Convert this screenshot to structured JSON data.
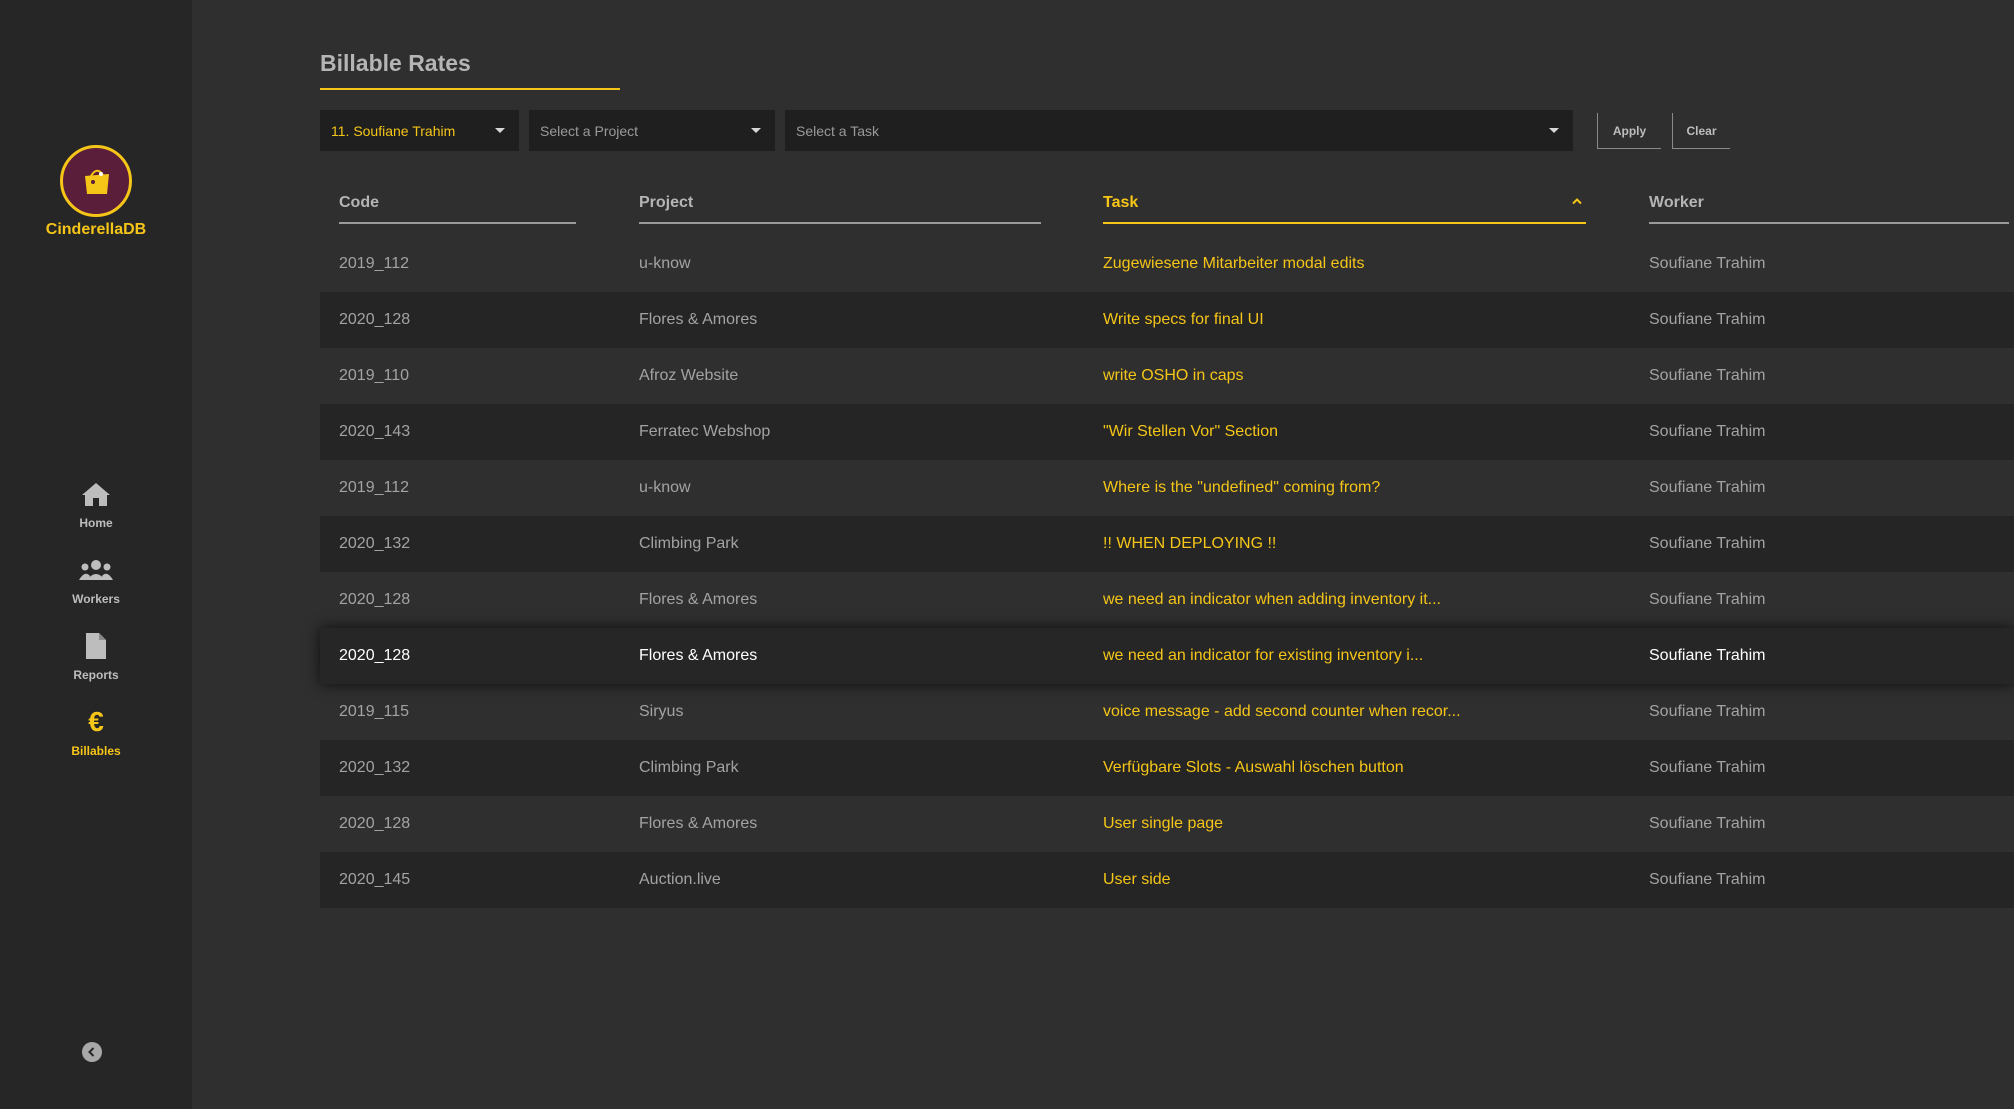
{
  "app": {
    "name": "CinderellaDB"
  },
  "sidebar": {
    "items": [
      {
        "label": "Home",
        "icon": "home-icon",
        "active": false
      },
      {
        "label": "Workers",
        "icon": "users-icon",
        "active": false
      },
      {
        "label": "Reports",
        "icon": "file-icon",
        "active": false
      },
      {
        "label": "Billables",
        "icon": "euro-icon",
        "active": true
      }
    ],
    "euro_symbol": "€"
  },
  "page": {
    "title": "Billable Rates"
  },
  "filters": {
    "worker_select": {
      "value": "11. Soufiane Trahim"
    },
    "project_select": {
      "placeholder": "Select a Project"
    },
    "task_select": {
      "placeholder": "Select a Task"
    },
    "apply_label": "Apply",
    "clear_label": "Clear"
  },
  "table": {
    "columns": [
      {
        "label": "Code"
      },
      {
        "label": "Project"
      },
      {
        "label": "Task",
        "sorted": "ascending"
      },
      {
        "label": "Worker"
      }
    ],
    "rows": [
      {
        "code": "2019_112",
        "project": "u-know",
        "task": "Zugewiesene Mitarbeiter modal edits",
        "worker": "Soufiane Trahim"
      },
      {
        "code": "2020_128",
        "project": "Flores & Amores",
        "task": "Write specs for final UI",
        "worker": "Soufiane Trahim"
      },
      {
        "code": "2019_110",
        "project": "Afroz Website",
        "task": "write OSHO in caps",
        "worker": "Soufiane Trahim"
      },
      {
        "code": "2020_143",
        "project": "Ferratec Webshop",
        "task": "\"Wir Stellen Vor\" Section",
        "worker": "Soufiane Trahim"
      },
      {
        "code": "2019_112",
        "project": "u-know",
        "task": "Where is the \"undefined\" coming from?",
        "worker": "Soufiane Trahim"
      },
      {
        "code": "2020_132",
        "project": "Climbing Park",
        "task": "!! WHEN DEPLOYING !!",
        "worker": "Soufiane Trahim"
      },
      {
        "code": "2020_128",
        "project": "Flores & Amores",
        "task": "we need an indicator when adding inventory it...",
        "worker": "Soufiane Trahim"
      },
      {
        "code": "2020_128",
        "project": "Flores & Amores",
        "task": "we need an indicator for existing inventory i...",
        "worker": "Soufiane Trahim",
        "hovered": true
      },
      {
        "code": "2019_115",
        "project": "Siryus",
        "task": "voice message - add second counter when recor...",
        "worker": "Soufiane Trahim"
      },
      {
        "code": "2020_132",
        "project": "Climbing Park",
        "task": "Verfügbare Slots - Auswahl löschen button",
        "worker": "Soufiane Trahim"
      },
      {
        "code": "2020_128",
        "project": "Flores & Amores",
        "task": "User single page",
        "worker": "Soufiane Trahim"
      },
      {
        "code": "2020_145",
        "project": "Auction.live",
        "task": "User side",
        "worker": "Soufiane Trahim"
      }
    ]
  },
  "colors": {
    "accent": "#f5c518",
    "background": "#2f2f2f",
    "sidebar": "#262626"
  }
}
